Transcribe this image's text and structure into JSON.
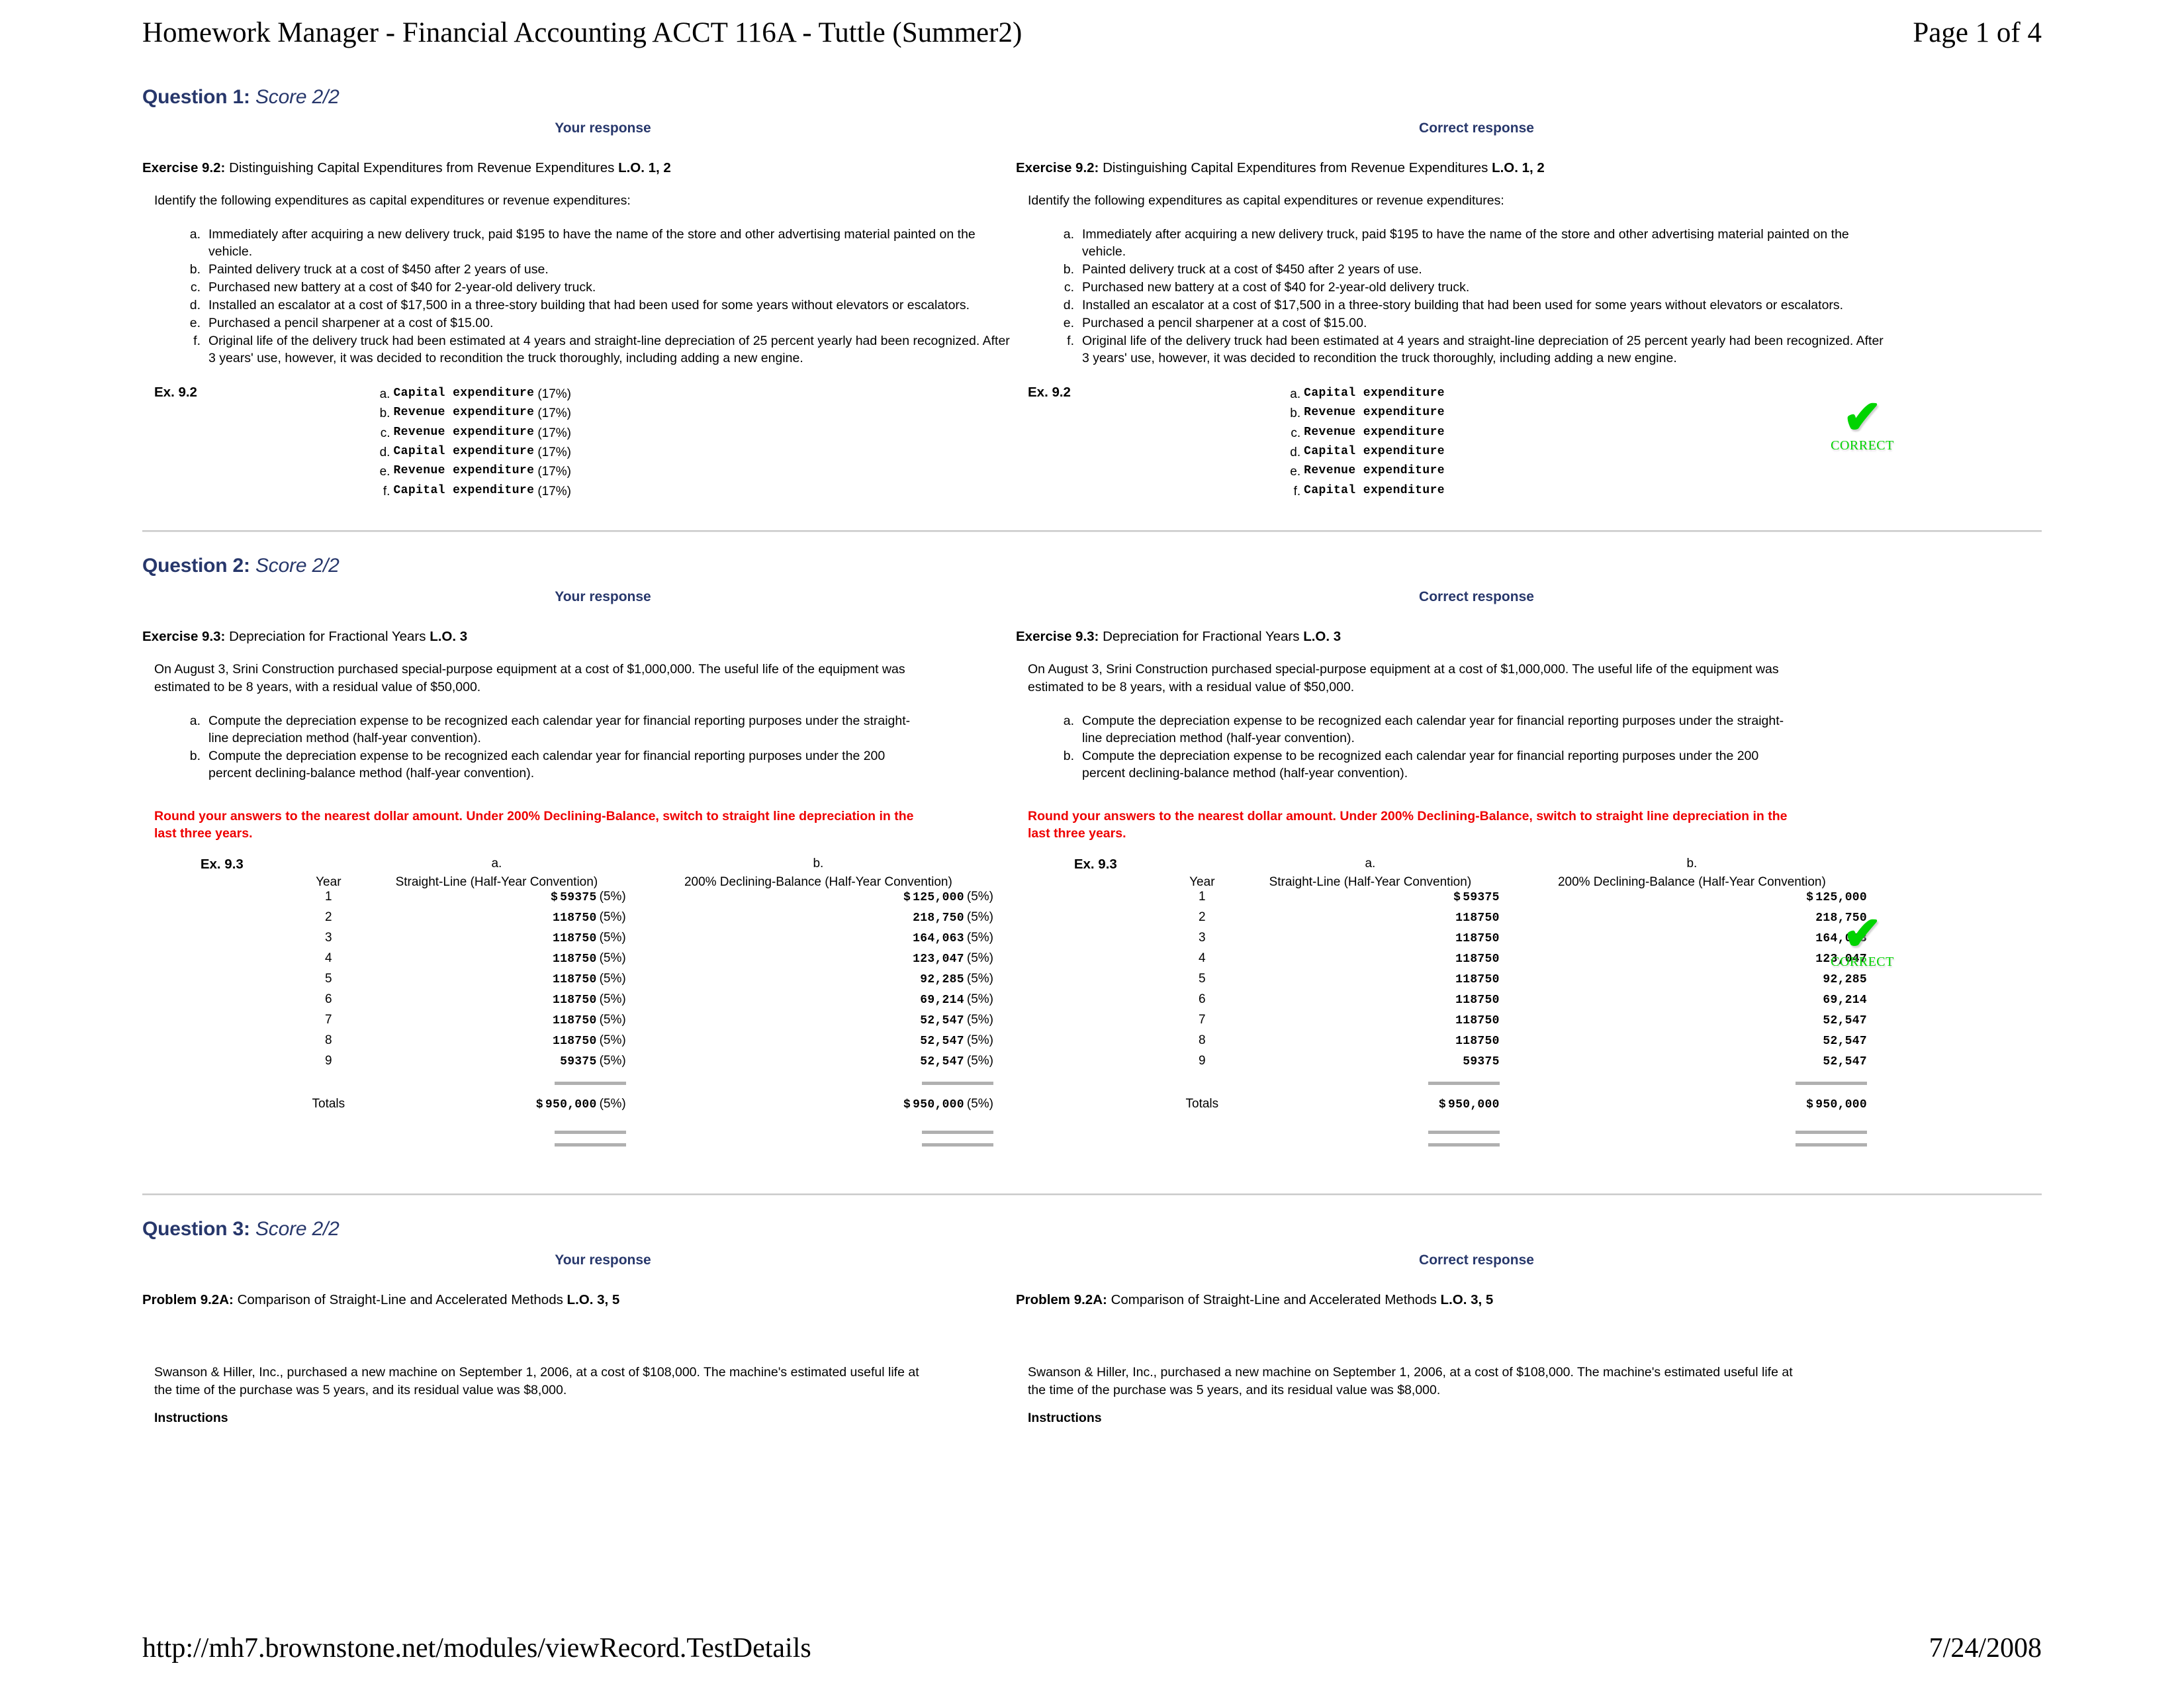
{
  "header": {
    "title": "Homework Manager - Financial Accounting ACCT 116A - Tuttle (Summer2)",
    "page_label": "Page 1 of 4"
  },
  "footer": {
    "url": "http://mh7.brownstone.net/modules/viewRecord.TestDetails",
    "date": "7/24/2008"
  },
  "labels": {
    "your_response": "Your response",
    "correct_response": "Correct response",
    "correct_badge_check": "✔",
    "correct_badge_word": "CORRECT",
    "instructions": "Instructions"
  },
  "colors": {
    "heading_blue": "#27376b",
    "warning_red": "#ee0000",
    "correct_green": "#00d400",
    "rule_gray": "#b0b0b0"
  },
  "q1": {
    "title_prefix": "Question 1:",
    "score": "Score 2/2",
    "exercise_label": "Exercise 9.2:",
    "exercise_name": "Distinguishing Capital Expenditures from Revenue Expenditures",
    "lo": "L.O. 1, 2",
    "intro": "Identify the following expenditures as capital expenditures or revenue expenditures:",
    "items": [
      {
        "marker": "a.",
        "text": "Immediately after acquiring a new delivery truck, paid $195 to have the name of the store and other advertising material painted on the vehicle."
      },
      {
        "marker": "b.",
        "text": "Painted delivery truck at a cost of $450 after 2 years of use."
      },
      {
        "marker": "c.",
        "text": "Purchased new battery at a cost of $40 for 2-year-old delivery truck."
      },
      {
        "marker": "d.",
        "text": "Installed an escalator at a cost of $17,500 in a three-story building that had been used for some years without elevators or escalators."
      },
      {
        "marker": "e.",
        "text": "Purchased a pencil sharpener at a cost of $15.00."
      },
      {
        "marker": "f.",
        "text": "Original life of the delivery truck had been estimated at 4 years and straight-line depreciation of 25 percent yearly had been recognized. After 3 years' use, however, it was decided to recondition the truck thoroughly, including adding a new engine."
      }
    ],
    "answer_label": "Ex. 9.2",
    "your_answers": [
      {
        "letter": "a.",
        "value": "Capital expenditure",
        "pct": "(17%)"
      },
      {
        "letter": "b.",
        "value": "Revenue expenditure",
        "pct": "(17%)"
      },
      {
        "letter": "c.",
        "value": "Revenue expenditure",
        "pct": "(17%)"
      },
      {
        "letter": "d.",
        "value": "Capital expenditure",
        "pct": "(17%)"
      },
      {
        "letter": "e.",
        "value": "Revenue expenditure",
        "pct": "(17%)"
      },
      {
        "letter": "f.",
        "value": "Capital expenditure",
        "pct": "(17%)"
      }
    ],
    "correct_answers": [
      {
        "letter": "a.",
        "value": "Capital expenditure",
        "pct": ""
      },
      {
        "letter": "b.",
        "value": "Revenue expenditure",
        "pct": ""
      },
      {
        "letter": "c.",
        "value": "Revenue expenditure",
        "pct": ""
      },
      {
        "letter": "d.",
        "value": "Capital expenditure",
        "pct": ""
      },
      {
        "letter": "e.",
        "value": "Revenue expenditure",
        "pct": ""
      },
      {
        "letter": "f.",
        "value": "Capital expenditure",
        "pct": ""
      }
    ]
  },
  "q2": {
    "title_prefix": "Question 2:",
    "score": "Score 2/2",
    "exercise_label": "Exercise 9.3:",
    "exercise_name": "Depreciation for Fractional Years",
    "lo": "L.O. 3",
    "intro": "On August 3, Srini Construction purchased special-purpose equipment at a cost of $1,000,000. The useful life of the equipment was estimated to be 8 years, with a residual value of $50,000.",
    "items": [
      {
        "marker": "a.",
        "text": "Compute the depreciation expense to be recognized each calendar year for financial reporting purposes under the straight-line depreciation method (half-year convention)."
      },
      {
        "marker": "b.",
        "text": "Compute the depreciation expense to be recognized each calendar year for financial reporting purposes under the 200 percent declining-balance method (half-year convention)."
      }
    ],
    "warning": "Round your answers to the nearest dollar amount. Under 200% Declining-Balance, switch to straight line depreciation in the last three years.",
    "answer_label": "Ex. 9.3",
    "col_a_letter": "a.",
    "col_b_letter": "b.",
    "col_year": "Year",
    "col_a_head": "Straight-Line (Half-Year Convention)",
    "col_b_head": "200% Declining-Balance (Half-Year Convention)",
    "totals_label": "Totals",
    "your_rows": [
      {
        "year": "1",
        "a": "59375",
        "a_dollar": "$",
        "a_pct": "(5%)",
        "b": "125,000",
        "b_dollar": "$",
        "b_pct": "(5%)"
      },
      {
        "year": "2",
        "a": "118750",
        "a_dollar": "",
        "a_pct": "(5%)",
        "b": "218,750",
        "b_dollar": "",
        "b_pct": "(5%)"
      },
      {
        "year": "3",
        "a": "118750",
        "a_dollar": "",
        "a_pct": "(5%)",
        "b": "164,063",
        "b_dollar": "",
        "b_pct": "(5%)"
      },
      {
        "year": "4",
        "a": "118750",
        "a_dollar": "",
        "a_pct": "(5%)",
        "b": "123,047",
        "b_dollar": "",
        "b_pct": "(5%)"
      },
      {
        "year": "5",
        "a": "118750",
        "a_dollar": "",
        "a_pct": "(5%)",
        "b": "92,285",
        "b_dollar": "",
        "b_pct": "(5%)"
      },
      {
        "year": "6",
        "a": "118750",
        "a_dollar": "",
        "a_pct": "(5%)",
        "b": "69,214",
        "b_dollar": "",
        "b_pct": "(5%)"
      },
      {
        "year": "7",
        "a": "118750",
        "a_dollar": "",
        "a_pct": "(5%)",
        "b": "52,547",
        "b_dollar": "",
        "b_pct": "(5%)"
      },
      {
        "year": "8",
        "a": "118750",
        "a_dollar": "",
        "a_pct": "(5%)",
        "b": "52,547",
        "b_dollar": "",
        "b_pct": "(5%)"
      },
      {
        "year": "9",
        "a": "59375",
        "a_dollar": "",
        "a_pct": "(5%)",
        "b": "52,547",
        "b_dollar": "",
        "b_pct": "(5%)"
      }
    ],
    "your_totals": {
      "a": "950,000",
      "a_dollar": "$",
      "a_pct": "(5%)",
      "b": "950,000",
      "b_dollar": "$",
      "b_pct": "(5%)"
    },
    "correct_rows": [
      {
        "year": "1",
        "a": "59375",
        "a_dollar": "$",
        "a_pct": "",
        "b": "125,000",
        "b_dollar": "$",
        "b_pct": ""
      },
      {
        "year": "2",
        "a": "118750",
        "a_dollar": "",
        "a_pct": "",
        "b": "218,750",
        "b_dollar": "",
        "b_pct": ""
      },
      {
        "year": "3",
        "a": "118750",
        "a_dollar": "",
        "a_pct": "",
        "b": "164,063",
        "b_dollar": "",
        "b_pct": ""
      },
      {
        "year": "4",
        "a": "118750",
        "a_dollar": "",
        "a_pct": "",
        "b": "123,047",
        "b_dollar": "",
        "b_pct": ""
      },
      {
        "year": "5",
        "a": "118750",
        "a_dollar": "",
        "a_pct": "",
        "b": "92,285",
        "b_dollar": "",
        "b_pct": ""
      },
      {
        "year": "6",
        "a": "118750",
        "a_dollar": "",
        "a_pct": "",
        "b": "69,214",
        "b_dollar": "",
        "b_pct": ""
      },
      {
        "year": "7",
        "a": "118750",
        "a_dollar": "",
        "a_pct": "",
        "b": "52,547",
        "b_dollar": "",
        "b_pct": ""
      },
      {
        "year": "8",
        "a": "118750",
        "a_dollar": "",
        "a_pct": "",
        "b": "52,547",
        "b_dollar": "",
        "b_pct": ""
      },
      {
        "year": "9",
        "a": "59375",
        "a_dollar": "",
        "a_pct": "",
        "b": "52,547",
        "b_dollar": "",
        "b_pct": ""
      }
    ],
    "correct_totals": {
      "a": "950,000",
      "a_dollar": "$",
      "a_pct": "",
      "b": "950,000",
      "b_dollar": "$",
      "b_pct": ""
    }
  },
  "q3": {
    "title_prefix": "Question 3:",
    "score": "Score 2/2",
    "exercise_label": "Problem 9.2A:",
    "exercise_name": "Comparison of Straight-Line and Accelerated Methods",
    "lo": "L.O. 3, 5",
    "intro": "Swanson & Hiller, Inc., purchased a new machine on September 1, 2006, at a cost of $108,000. The machine's estimated useful life at the time of the purchase was 5 years, and its residual value was $8,000."
  }
}
